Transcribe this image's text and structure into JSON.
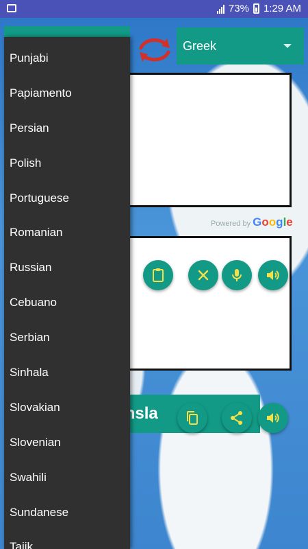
{
  "status_bar": {
    "battery": "73%",
    "time": "1:29 AM"
  },
  "target_language": "Greek",
  "powered_by": {
    "prefix": "Powered by",
    "brand": [
      "G",
      "o",
      "o",
      "g",
      "l",
      "e"
    ]
  },
  "translate_label": "ransla",
  "language_list": [
    "Punjabi",
    "Papiamento",
    "Persian",
    "Polish",
    "Portuguese",
    "Romanian",
    "Russian",
    "Cebuano",
    "Serbian",
    "Sinhala",
    "Slovakian",
    "Slovenian",
    "Swahili",
    "Sundanese",
    "Tajik"
  ],
  "colors": {
    "accent": "#129a86",
    "status_bar": "#4a52b8",
    "drawer": "#303030",
    "icon_yellow": "#f5e04a"
  },
  "icons": {
    "paste": "clipboard-icon",
    "clear": "close-icon",
    "mic": "mic-icon",
    "speak_input": "volume-icon",
    "copy": "copy-icon",
    "share": "share-icon",
    "speak_output": "volume-icon",
    "swap": "swap-arrows-icon"
  }
}
